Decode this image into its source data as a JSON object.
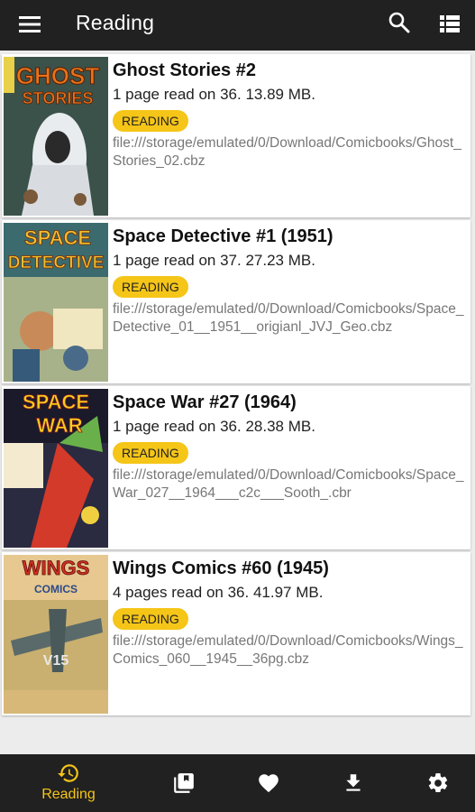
{
  "appbar": {
    "title": "Reading"
  },
  "colors": {
    "appbar": "#212121",
    "accent": "#f5c518",
    "background": "#ececec",
    "card": "#ffffff"
  },
  "icons": {
    "menu": "menu-icon",
    "search": "search-icon",
    "view_list": "view-list-icon",
    "history": "history-icon",
    "library": "library-icon",
    "favorite": "heart-icon",
    "download": "download-icon",
    "settings": "gear-icon"
  },
  "comics": [
    {
      "title": "Ghost Stories #2",
      "progress": "1 page read on 36.  13.89 MB.",
      "status": "READING",
      "path": "file:///storage/emulated/0/Download/Comicbooks/Ghost_Stories_02.cbz",
      "cover_text": [
        "GHOST",
        "STORIES"
      ]
    },
    {
      "title": "Space Detective #1 (1951)",
      "progress": "1 page read on 37.  27.23 MB.",
      "status": "READING",
      "path": "file:///storage/emulated/0/Download/Comicbooks/Space_Detective_01__1951__origianl_JVJ_Geo.cbz",
      "cover_text": [
        "SPACE",
        "DETECTIVE"
      ]
    },
    {
      "title": "Space War #27 (1964)",
      "progress": "1 page read on 36.  28.38 MB.",
      "status": "READING",
      "path": "file:///storage/emulated/0/Download/Comicbooks/Space_War_027__1964___c2c___Sooth_.cbr",
      "cover_text": [
        "SPACE",
        "WAR"
      ]
    },
    {
      "title": "Wings Comics #60 (1945)",
      "progress": "4 pages read on 36.  41.97 MB.",
      "status": "READING",
      "path": "file:///storage/emulated/0/Download/Comicbooks/Wings_Comics_060__1945__36pg.cbz",
      "cover_text": [
        "WINGS",
        "COMICS"
      ]
    }
  ],
  "bottom_nav": {
    "reading_label": "Reading"
  }
}
